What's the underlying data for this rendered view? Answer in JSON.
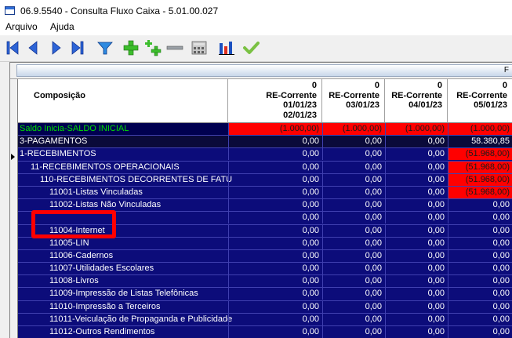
{
  "window": {
    "title": "06.9.5540 - Consulta Fluxo Caixa - 5.01.00.027"
  },
  "menu": [
    {
      "label": "Arquivo"
    },
    {
      "label": "Ajuda"
    }
  ],
  "toolbar": {
    "icons": [
      "first-record-icon",
      "previous-record-icon",
      "next-record-icon",
      "last-record-icon",
      "filter-icon",
      "add-icon",
      "add-multiple-icon",
      "remove-icon",
      "calculator-icon",
      "bar-chart-icon",
      "confirm-check-icon"
    ]
  },
  "band": {
    "label": "F"
  },
  "header": {
    "composicao": "Composição",
    "columns": [
      {
        "l1": "0",
        "l2": "RE-Corrente",
        "l3": "01/01/23",
        "l4": "02/01/23"
      },
      {
        "l1": "0",
        "l2": "RE-Corrente",
        "l3": "03/01/23",
        "l4": ""
      },
      {
        "l1": "0",
        "l2": "RE-Corrente",
        "l3": "04/01/23",
        "l4": ""
      },
      {
        "l1": "0",
        "l2": "RE-Corrente",
        "l3": "05/01/23",
        "l4": ""
      }
    ]
  },
  "rows": [
    {
      "label": "Saldo Inicia-SALDO INICIAL",
      "indent": 0,
      "type": "saldo",
      "values": [
        "(1.000,00)",
        "(1.000,00)",
        "(1.000,00)",
        "(1.000,00)"
      ],
      "neg": [
        true,
        true,
        true,
        true
      ]
    },
    {
      "label": "3-PAGAMENTOS",
      "indent": 0,
      "type": "sel",
      "values": [
        "0,00",
        "0,00",
        "0,00",
        "58.380,85"
      ],
      "neg": [
        false,
        false,
        false,
        false
      ]
    },
    {
      "label": "1-RECEBIMENTOS",
      "indent": 0,
      "values": [
        "0,00",
        "0,00",
        "0,00",
        "(51.968,00)"
      ],
      "neg": [
        false,
        false,
        false,
        true
      ]
    },
    {
      "label": "11-RECEBIMENTOS OPERACIONAIS",
      "indent": 1,
      "values": [
        "0,00",
        "0,00",
        "0,00",
        "(51.968,00)"
      ],
      "neg": [
        false,
        false,
        false,
        true
      ]
    },
    {
      "label": "110-RECEBIMENTOS DECORRENTES DE FATU",
      "indent": 2,
      "values": [
        "0,00",
        "0,00",
        "0,00",
        "(51.968,00)"
      ],
      "neg": [
        false,
        false,
        false,
        true
      ]
    },
    {
      "label": "11001-Listas Vinculadas",
      "indent": 3,
      "values": [
        "0,00",
        "0,00",
        "0,00",
        "(51.968,00)"
      ],
      "neg": [
        false,
        false,
        false,
        true
      ]
    },
    {
      "label": "11002-Listas Não Vinculadas",
      "indent": 3,
      "values": [
        "0,00",
        "0,00",
        "0,00",
        "0,00"
      ],
      "neg": [
        false,
        false,
        false,
        false
      ]
    },
    {
      "label": "",
      "indent": 3,
      "values": [
        "0,00",
        "0,00",
        "0,00",
        "0,00"
      ],
      "neg": [
        false,
        false,
        false,
        false
      ]
    },
    {
      "label": "11004-Internet",
      "indent": 3,
      "values": [
        "0,00",
        "0,00",
        "0,00",
        "0,00"
      ],
      "neg": [
        false,
        false,
        false,
        false
      ]
    },
    {
      "label": "11005-LIN",
      "indent": 3,
      "values": [
        "0,00",
        "0,00",
        "0,00",
        "0,00"
      ],
      "neg": [
        false,
        false,
        false,
        false
      ]
    },
    {
      "label": "11006-Cadernos",
      "indent": 3,
      "values": [
        "0,00",
        "0,00",
        "0,00",
        "0,00"
      ],
      "neg": [
        false,
        false,
        false,
        false
      ]
    },
    {
      "label": "11007-Utilidades Escolares",
      "indent": 3,
      "values": [
        "0,00",
        "0,00",
        "0,00",
        "0,00"
      ],
      "neg": [
        false,
        false,
        false,
        false
      ]
    },
    {
      "label": "11008-Livros",
      "indent": 3,
      "values": [
        "0,00",
        "0,00",
        "0,00",
        "0,00"
      ],
      "neg": [
        false,
        false,
        false,
        false
      ]
    },
    {
      "label": "11009-Impressão de Listas Telefônicas",
      "indent": 3,
      "values": [
        "0,00",
        "0,00",
        "0,00",
        "0,00"
      ],
      "neg": [
        false,
        false,
        false,
        false
      ]
    },
    {
      "label": "11010-Impressão a Terceiros",
      "indent": 3,
      "values": [
        "0,00",
        "0,00",
        "0,00",
        "0,00"
      ],
      "neg": [
        false,
        false,
        false,
        false
      ]
    },
    {
      "label": "11011-Veiculação de Propaganda e Publicidade",
      "indent": 3,
      "values": [
        "0,00",
        "0,00",
        "0,00",
        "0,00"
      ],
      "neg": [
        false,
        false,
        false,
        false
      ]
    },
    {
      "label": "11012-Outros Rendimentos",
      "indent": 3,
      "values": [
        "0,00",
        "0,00",
        "0,00",
        "0,00"
      ],
      "neg": [
        false,
        false,
        false,
        false
      ]
    },
    {
      "label": "",
      "indent": 3,
      "values": [
        "0,00",
        "0,00",
        "0,00",
        "0,00"
      ],
      "neg": [
        false,
        false,
        false,
        false
      ]
    }
  ],
  "colors": {
    "row_bg": "#0c0c7a",
    "negative_bg": "#ff0000",
    "saldo_text": "#00e000",
    "highlight": "#ff0000"
  }
}
